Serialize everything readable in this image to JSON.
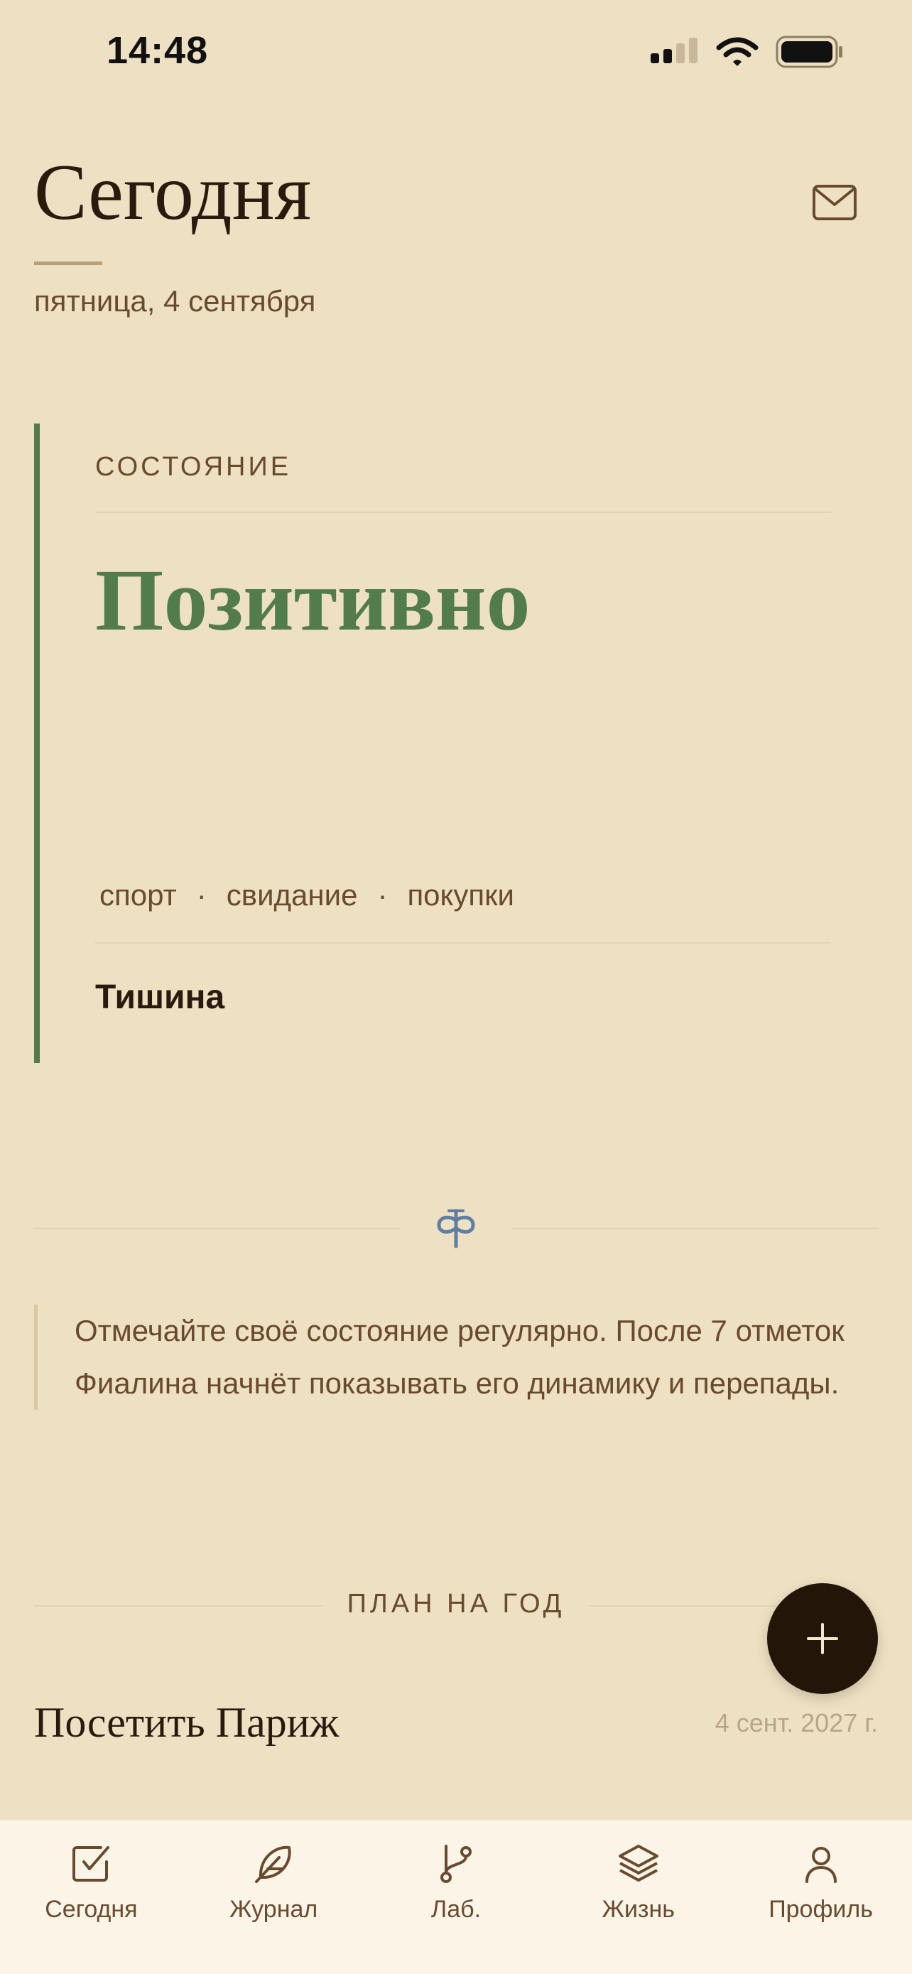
{
  "status_bar": {
    "time": "14:48"
  },
  "header": {
    "title": "Сегодня",
    "date": "пятница, 4 сентября"
  },
  "state_card": {
    "label": "СОСТОЯНИЕ",
    "value": "Позитивно",
    "tags": [
      "спорт",
      "свидание",
      "покупки"
    ],
    "separator": "·",
    "note": "Тишина",
    "accent_color": "#527C4C"
  },
  "tip": {
    "text": "Отмечайте своё состояние регулярно. После 7 отметок Фиалина начнёт показывать его динамику и перепады."
  },
  "plan": {
    "heading": "ПЛАН НА ГОД",
    "items": [
      {
        "title": "Посетить Париж",
        "date": "4 сент. 2027 г."
      }
    ]
  },
  "fab": {
    "icon": "plus-icon"
  },
  "bottom_nav": {
    "items": [
      {
        "label": "Сегодня",
        "icon": "checkbox-icon"
      },
      {
        "label": "Журнал",
        "icon": "feather-icon"
      },
      {
        "label": "Лаб.",
        "icon": "branch-icon"
      },
      {
        "label": "Жизнь",
        "icon": "layers-icon"
      },
      {
        "label": "Профиль",
        "icon": "user-icon"
      }
    ]
  }
}
